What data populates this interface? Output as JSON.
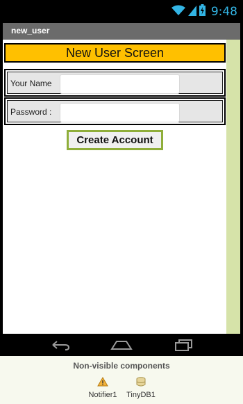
{
  "status_bar": {
    "time": "9:48",
    "icons": [
      "wifi-icon",
      "signal-icon",
      "battery-icon"
    ]
  },
  "app": {
    "title": "new_user"
  },
  "screen": {
    "header_label": "New User Screen",
    "name_label": "Your Name",
    "name_value": "",
    "password_label": "Password :",
    "password_value": "",
    "create_button": "Create Account"
  },
  "nav_bar": {
    "icons": [
      "back-icon",
      "home-icon",
      "recent-apps-icon"
    ]
  },
  "non_visible": {
    "title": "Non-visible components",
    "components": [
      {
        "name": "Notifier1",
        "icon": "warning-icon"
      },
      {
        "name": "TinyDB1",
        "icon": "database-icon"
      }
    ]
  },
  "colors": {
    "header_bg": "#ffc000",
    "accent": "#33b5e5",
    "button_border": "#8fae3a",
    "side_strip": "#d6e3a9"
  }
}
